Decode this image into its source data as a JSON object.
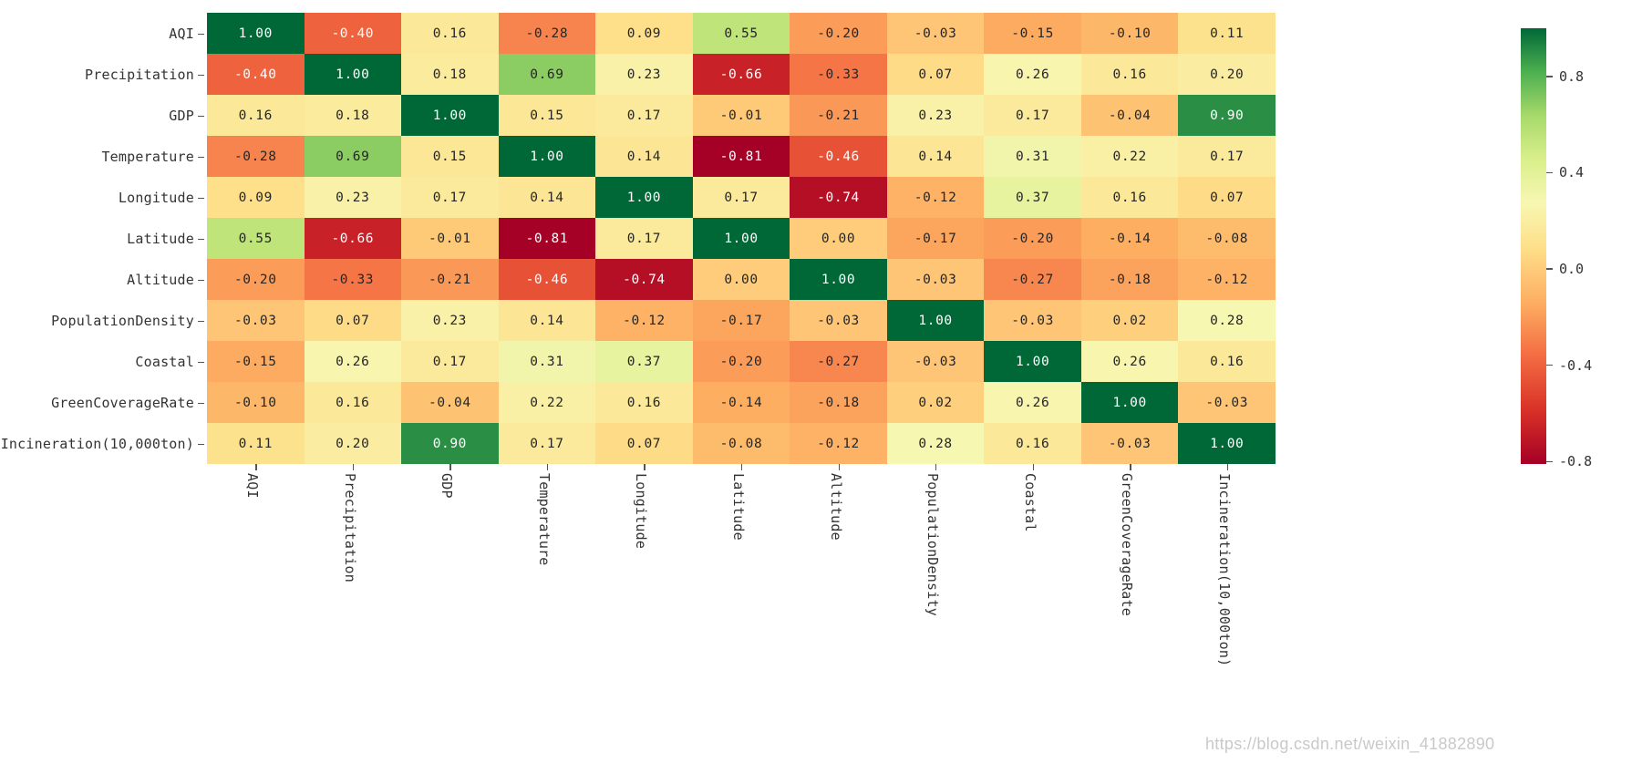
{
  "figure": {
    "kind": "correlation-heatmap",
    "background_color": "#ffffff",
    "watermark_text": "https://blog.csdn.net/weixin_41882890",
    "watermark_color": "#c9c9c9"
  },
  "chart_data": {
    "type": "heatmap",
    "title": "",
    "xlabel": "",
    "ylabel": "",
    "grid": false,
    "annotated": true,
    "value_format": "0.00",
    "colormap": "RdYlGn",
    "colorbar": {
      "position": "right",
      "vmin": -0.81,
      "vmax": 1.0,
      "tick_values": [
        0.8,
        0.4,
        0.0,
        -0.4,
        -0.8
      ],
      "tick_labels": [
        "0.8",
        "0.4",
        "0.0",
        "-0.4",
        "-0.8"
      ],
      "stops": [
        {
          "t": 0.0,
          "color": "#a50026"
        },
        {
          "t": 0.12,
          "color": "#d73027"
        },
        {
          "t": 0.25,
          "color": "#f46d43"
        },
        {
          "t": 0.37,
          "color": "#fdae61"
        },
        {
          "t": 0.5,
          "color": "#fee08b"
        },
        {
          "t": 0.6,
          "color": "#f7f7b2"
        },
        {
          "t": 0.7,
          "color": "#d9ef8b"
        },
        {
          "t": 0.8,
          "color": "#a6d96a"
        },
        {
          "t": 0.9,
          "color": "#4caf50"
        },
        {
          "t": 1.0,
          "color": "#006837"
        }
      ]
    },
    "categories": [
      "AQI",
      "Precipitation",
      "GDP",
      "Temperature",
      "Longitude",
      "Latitude",
      "Altitude",
      "PopulationDensity",
      "Coastal",
      "GreenCoverageRate",
      "Incineration(10,000ton)"
    ],
    "x_tick_labels": [
      "AQI",
      "Precipitation",
      "GDP",
      "Temperature",
      "Longitude",
      "Latitude",
      "Altitude",
      "PopulationDensity",
      "Coastal",
      "GreenCoverageRate",
      "Incineration(10,000ton)"
    ],
    "y_tick_labels": [
      "AQI",
      "Precipitation",
      "GDP",
      "Temperature",
      "Longitude",
      "Latitude",
      "Altitude",
      "PopulationDensity",
      "Coastal",
      "GreenCoverageRate",
      "Incineration(10,000ton)"
    ],
    "values": [
      [
        1.0,
        -0.4,
        0.16,
        -0.28,
        0.09,
        0.55,
        -0.2,
        -0.03,
        -0.15,
        -0.1,
        0.11
      ],
      [
        -0.4,
        1.0,
        0.18,
        0.69,
        0.23,
        -0.66,
        -0.33,
        0.07,
        0.26,
        0.16,
        0.2
      ],
      [
        0.16,
        0.18,
        1.0,
        0.15,
        0.17,
        -0.01,
        -0.21,
        0.23,
        0.17,
        -0.04,
        0.9
      ],
      [
        -0.28,
        0.69,
        0.15,
        1.0,
        0.14,
        -0.81,
        -0.46,
        0.14,
        0.31,
        0.22,
        0.17
      ],
      [
        0.09,
        0.23,
        0.17,
        0.14,
        1.0,
        0.17,
        -0.74,
        -0.12,
        0.37,
        0.16,
        0.07
      ],
      [
        0.55,
        -0.66,
        -0.01,
        -0.81,
        0.17,
        1.0,
        0.0,
        -0.17,
        -0.2,
        -0.14,
        -0.08
      ],
      [
        -0.2,
        -0.33,
        -0.21,
        -0.46,
        -0.74,
        0.0,
        1.0,
        -0.03,
        -0.27,
        -0.18,
        -0.12
      ],
      [
        -0.03,
        0.07,
        0.23,
        0.14,
        -0.12,
        -0.17,
        -0.03,
        1.0,
        -0.03,
        0.02,
        0.28
      ],
      [
        -0.15,
        0.26,
        0.17,
        0.31,
        0.37,
        -0.2,
        -0.27,
        -0.03,
        1.0,
        0.26,
        0.16
      ],
      [
        -0.1,
        0.16,
        -0.04,
        0.22,
        0.16,
        -0.14,
        -0.18,
        0.02,
        0.26,
        1.0,
        -0.03
      ],
      [
        0.11,
        0.2,
        0.9,
        0.17,
        0.07,
        -0.08,
        -0.12,
        0.28,
        0.16,
        -0.03,
        1.0
      ]
    ],
    "cell_labels": [
      [
        "1.00",
        "-0.40",
        "0.16",
        "-0.28",
        "0.09",
        "0.55",
        "-0.20",
        "-0.03",
        "-0.15",
        "-0.10",
        "0.11"
      ],
      [
        "-0.40",
        "1.00",
        "0.18",
        "0.69",
        "0.23",
        "-0.66",
        "-0.33",
        "0.07",
        "0.26",
        "0.16",
        "0.20"
      ],
      [
        "0.16",
        "0.18",
        "1.00",
        "0.15",
        "0.17",
        "-0.01",
        "-0.21",
        "0.23",
        "0.17",
        "-0.04",
        "0.90"
      ],
      [
        "-0.28",
        "0.69",
        "0.15",
        "1.00",
        "0.14",
        "-0.81",
        "-0.46",
        "0.14",
        "0.31",
        "0.22",
        "0.17"
      ],
      [
        "0.09",
        "0.23",
        "0.17",
        "0.14",
        "1.00",
        "0.17",
        "-0.74",
        "-0.12",
        "0.37",
        "0.16",
        "0.07"
      ],
      [
        "0.55",
        "-0.66",
        "-0.01",
        "-0.81",
        "0.17",
        "1.00",
        "0.00",
        "-0.17",
        "-0.20",
        "-0.14",
        "-0.08"
      ],
      [
        "-0.20",
        "-0.33",
        "-0.21",
        "-0.46",
        "-0.74",
        "0.00",
        "1.00",
        "-0.03",
        "-0.27",
        "-0.18",
        "-0.12"
      ],
      [
        "-0.03",
        "0.07",
        "0.23",
        "0.14",
        "-0.12",
        "-0.17",
        "-0.03",
        "1.00",
        "-0.03",
        "0.02",
        "0.28"
      ],
      [
        "-0.15",
        "0.26",
        "0.17",
        "0.31",
        "0.37",
        "-0.20",
        "-0.27",
        "-0.03",
        "1.00",
        "0.26",
        "0.16"
      ],
      [
        "-0.10",
        "0.16",
        "-0.04",
        "0.22",
        "0.16",
        "-0.14",
        "-0.18",
        "0.02",
        "0.26",
        "1.00",
        "-0.03"
      ],
      [
        "0.11",
        "0.20",
        "0.90",
        "0.17",
        "0.07",
        "-0.08",
        "-0.12",
        "0.28",
        "0.16",
        "-0.03",
        "1.00"
      ]
    ]
  }
}
